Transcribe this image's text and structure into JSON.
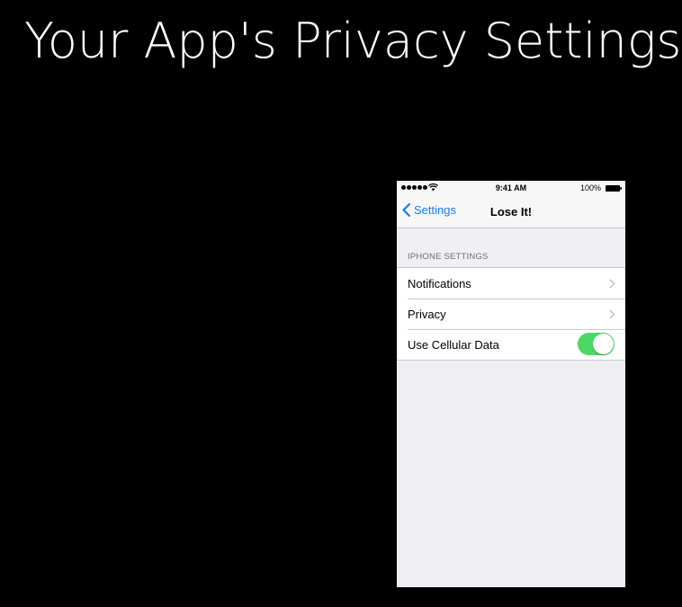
{
  "slide": {
    "title": "Your App's Privacy Settings"
  },
  "status_bar": {
    "time": "9:41 AM",
    "battery": "100%",
    "icons": [
      "signal-dots-icon",
      "wifi-icon",
      "battery-icon"
    ]
  },
  "nav": {
    "back_label": "Settings",
    "title": "Lose It!"
  },
  "section": {
    "header": "IPHONE SETTINGS",
    "rows": [
      {
        "label": "Notifications",
        "accessory": "chevron-right-icon"
      },
      {
        "label": "Privacy",
        "accessory": "chevron-right-icon"
      },
      {
        "label": "Use Cellular Data",
        "accessory": "toggle",
        "toggle_on": true
      }
    ]
  },
  "colors": {
    "background": "#000000",
    "tint": "#1a7cf2",
    "toggle_on": "#4cd964",
    "group_background": "#efeff4"
  }
}
